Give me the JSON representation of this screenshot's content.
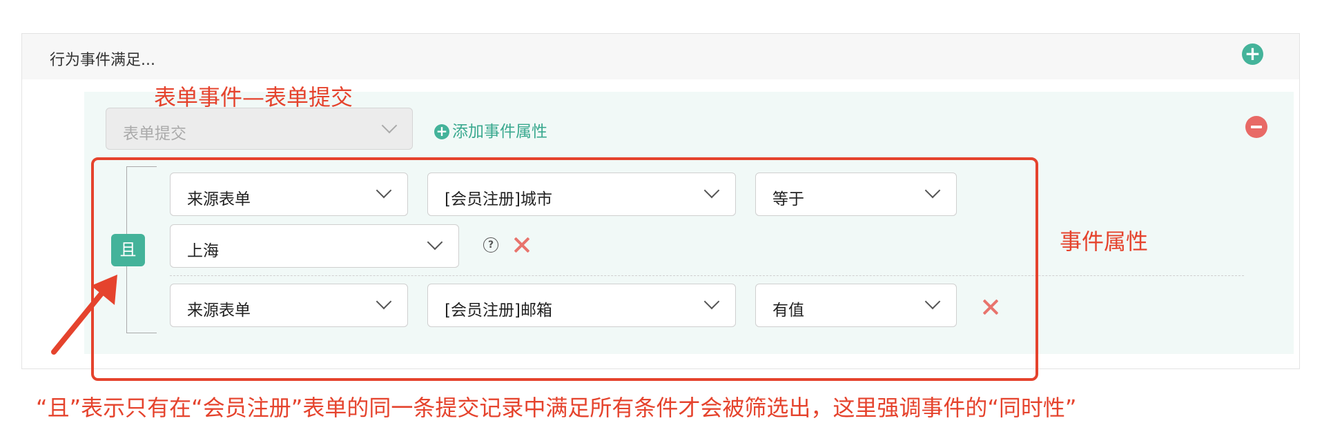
{
  "panel": {
    "title": "行为事件满足..."
  },
  "event": {
    "select_value": "表单提交",
    "add_attr_label": "添加事件属性"
  },
  "conditions": {
    "logic_label": "且",
    "rows": [
      {
        "source": "来源表单",
        "field": "[会员注册]城市",
        "operator": "等于",
        "value": "上海"
      },
      {
        "source": "来源表单",
        "field": "[会员注册]邮箱",
        "operator": "有值"
      }
    ]
  },
  "annotations": {
    "title": "表单事件—表单提交",
    "side": "事件属性",
    "bottom": "“且”表示只有在“会员注册”表单的同一条提交记录中满足所有条件才会被筛选出，这里强调事件的“同时性”"
  },
  "colors": {
    "accent": "#44b39a",
    "danger": "#e86a66",
    "annotation": "#e5432d"
  },
  "icons": [
    "add-circle-icon",
    "remove-circle-icon",
    "chevron-down-icon",
    "help-icon",
    "close-icon",
    "arrow-icon"
  ]
}
